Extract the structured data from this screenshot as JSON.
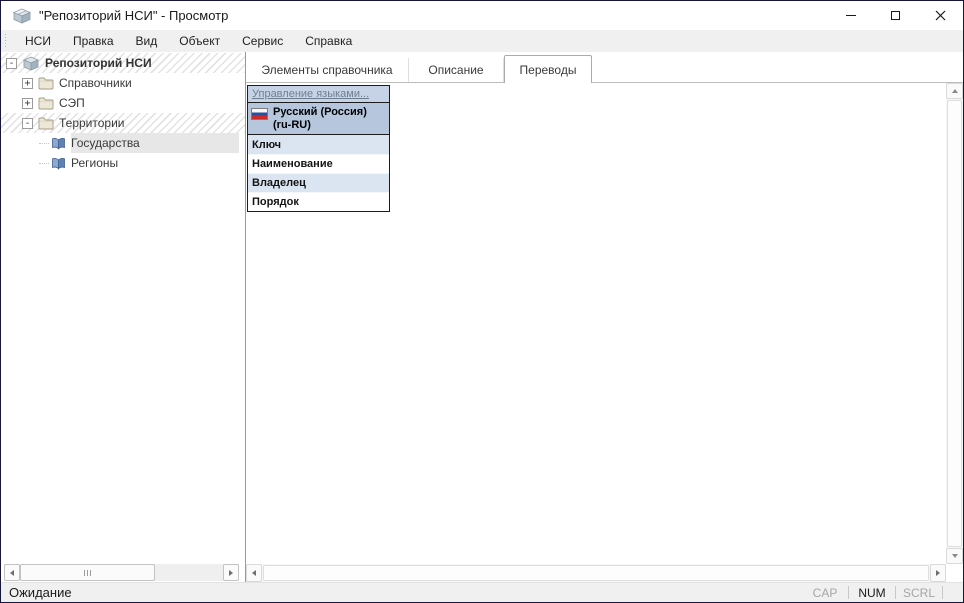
{
  "titlebar": {
    "title": "\"Репозиторий НСИ\" - Просмотр",
    "icons": {
      "app": "package-icon",
      "minimize": "minimize-icon",
      "maximize": "maximize-icon",
      "close": "close-icon"
    }
  },
  "menubar": {
    "items": [
      "НСИ",
      "Правка",
      "Вид",
      "Объект",
      "Сервис",
      "Справка"
    ]
  },
  "tree": {
    "rows": [
      {
        "label": "Репозиторий НСИ",
        "level": 0,
        "expander": "minus",
        "icon": "repository-package-icon",
        "hatched": true,
        "selected": false
      },
      {
        "label": "Справочники",
        "level": 1,
        "expander": "plus",
        "icon": "folder-icon",
        "hatched": false,
        "selected": false
      },
      {
        "label": "СЭП",
        "level": 1,
        "expander": "plus",
        "icon": "folder-icon",
        "hatched": false,
        "selected": false
      },
      {
        "label": "Территории",
        "level": 1,
        "expander": "minus",
        "icon": "folder-icon",
        "hatched": true,
        "selected": false
      },
      {
        "label": "Государства",
        "level": 2,
        "expander": "none",
        "icon": "book-icon",
        "hatched": false,
        "selected": true
      },
      {
        "label": "Регионы",
        "level": 2,
        "expander": "none",
        "icon": "book-icon",
        "hatched": false,
        "selected": false
      }
    ]
  },
  "tabs": [
    {
      "label": "Элементы справочника",
      "active": false
    },
    {
      "label": "Описание",
      "active": false
    },
    {
      "label": "Переводы",
      "active": true
    }
  ],
  "translations_panel": {
    "manage_languages_link": "Управление языками...",
    "language_name": "Русский (Россия) (ru-RU)",
    "language_flag": "russia-flag-icon",
    "fields": [
      "Ключ",
      "Наименование",
      "Владелец",
      "Порядок"
    ]
  },
  "statusbar": {
    "status": "Ожидание",
    "keyboard_indicators": [
      {
        "label": "CAP",
        "active": false
      },
      {
        "label": "NUM",
        "active": true
      },
      {
        "label": "SCRL",
        "active": false
      }
    ]
  },
  "colors": {
    "window_border": "#16163a",
    "table_link_header_bg": "#c6d3e7",
    "table_language_header_bg": "#b6c7dd",
    "table_row_alt_bg": "#dbe5f1",
    "tree_selection_bg": "#e7e7e7",
    "link_text": "#6e7e90",
    "menubar_bg": "#f0f0f0"
  }
}
